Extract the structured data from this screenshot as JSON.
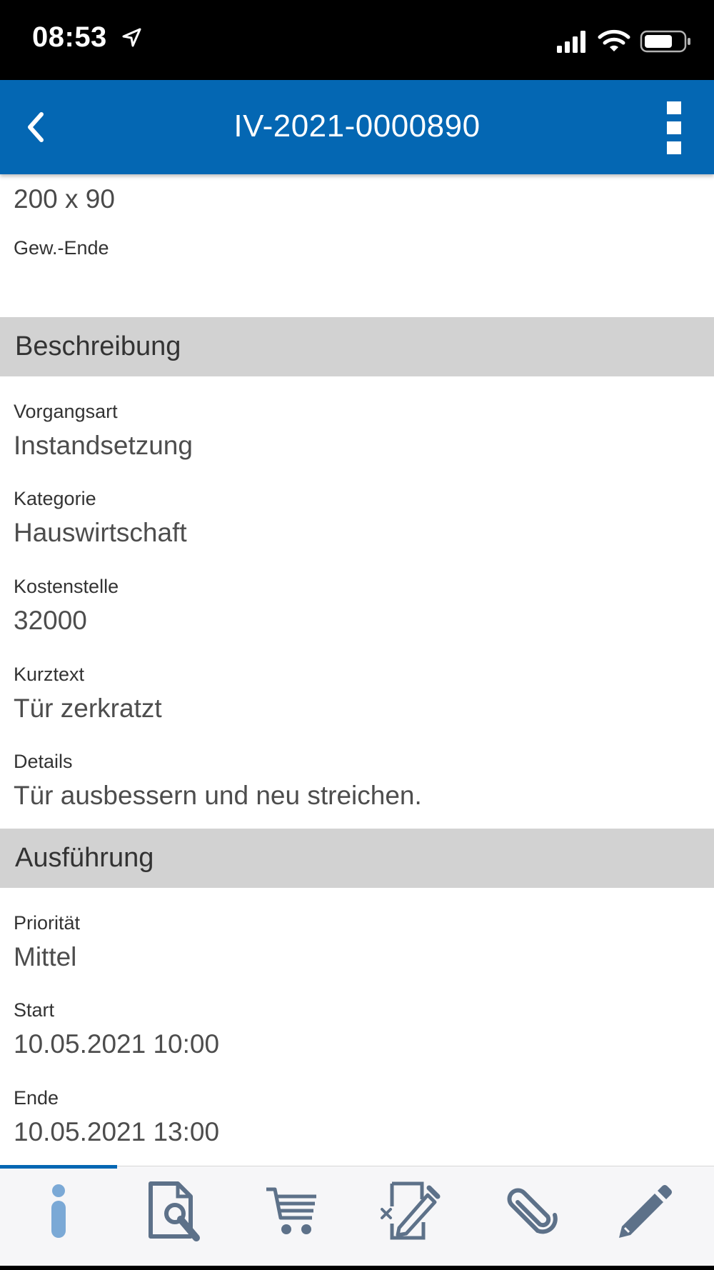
{
  "status_bar": {
    "time": "08:53"
  },
  "nav": {
    "title": "IV-2021-0000890"
  },
  "top": {
    "value": "200 x 90",
    "label": "Gew.-Ende"
  },
  "sections": {
    "beschreibung": "Beschreibung",
    "ausfuehrung": "Ausführung"
  },
  "fields": {
    "vorgangsart": {
      "label": "Vorgangsart",
      "value": "Instandsetzung"
    },
    "kategorie": {
      "label": "Kategorie",
      "value": "Hauswirtschaft"
    },
    "kostenstelle": {
      "label": "Kostenstelle",
      "value": "32000"
    },
    "kurztext": {
      "label": "Kurztext",
      "value": "Tür zerkratzt"
    },
    "details": {
      "label": "Details",
      "value": "Tür ausbessern und neu streichen."
    },
    "prioritaet": {
      "label": "Priorität",
      "value": "Mittel"
    },
    "start": {
      "label": "Start",
      "value": "10.05.2021 10:00"
    },
    "ende": {
      "label": "Ende",
      "value": "10.05.2021 13:00"
    }
  },
  "tabs": [
    {
      "icon": "info-icon",
      "active": true
    },
    {
      "icon": "document-wrench-icon",
      "active": false
    },
    {
      "icon": "cart-icon",
      "active": false
    },
    {
      "icon": "signature-icon",
      "active": false
    },
    {
      "icon": "paperclip-icon",
      "active": false
    },
    {
      "icon": "pencil-icon",
      "active": false
    }
  ],
  "colors": {
    "primary": "#0467b3",
    "section_bg": "#d2d2d2",
    "tab_icon": "#5d7189",
    "tab_active": "#7ba9d6"
  }
}
